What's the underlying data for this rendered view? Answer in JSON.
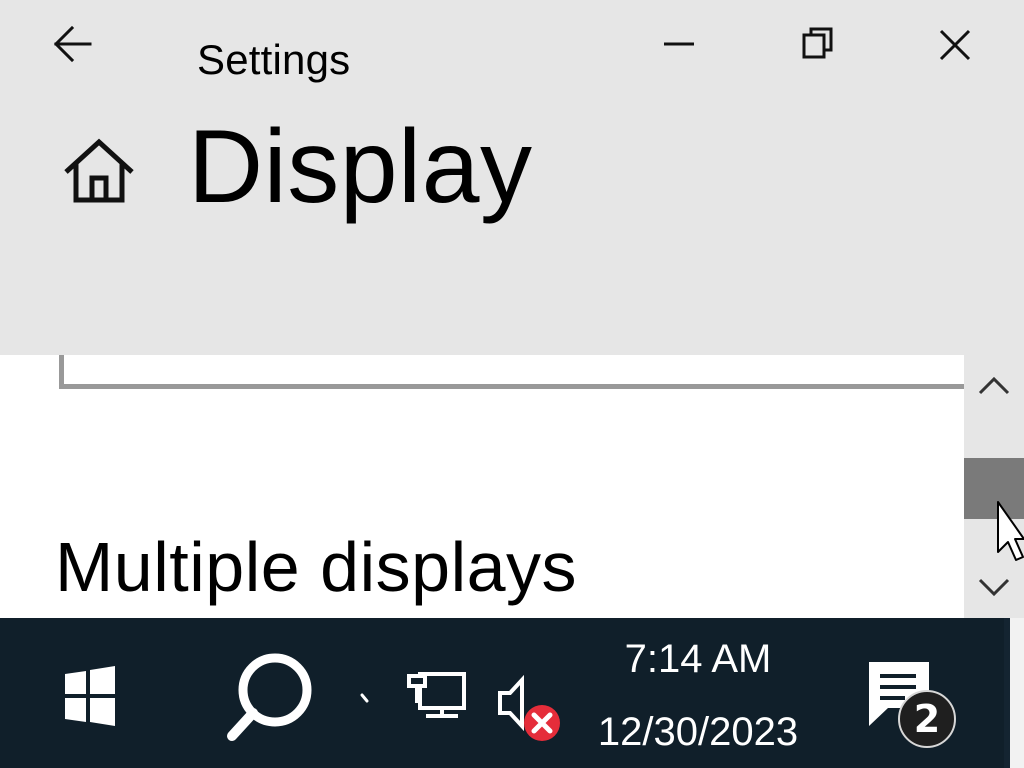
{
  "window": {
    "title": "Settings",
    "controls": {
      "back": "back-arrow-icon",
      "minimize": "minimize-icon",
      "maximize": "restore-icon",
      "close": "close-icon"
    }
  },
  "page": {
    "title": "Display",
    "home_icon": "home-icon"
  },
  "content": {
    "section_heading": "Multiple displays"
  },
  "scrollbar": {
    "up_icon": "chevron-up-icon",
    "down_icon": "chevron-down-icon"
  },
  "taskbar": {
    "time": "7:14 AM",
    "date": "12/30/2023",
    "notification_count": "2",
    "icons": {
      "start": "windows-logo-icon",
      "search": "search-icon",
      "tray_chevron": "tray-chevron-icon",
      "network": "network-icon",
      "volume": "volume-muted-icon",
      "notifications": "notifications-icon"
    }
  },
  "colors": {
    "settings_background": "#e6e6e6",
    "content_background": "#ffffff",
    "taskbar_background": "#101f2a",
    "scrollbar_thumb": "#7a7a7a",
    "volume_error": "#e52d3a"
  }
}
